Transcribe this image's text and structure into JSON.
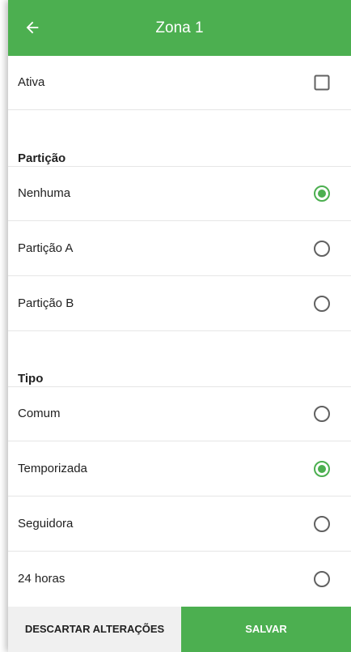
{
  "appbar": {
    "title": "Zona 1",
    "back_icon": "arrow-left-icon"
  },
  "colors": {
    "accent": "#4caf50",
    "control_unchecked": "#616161"
  },
  "ativa": {
    "label": "Ativa",
    "checked": false
  },
  "particao": {
    "header": "Partição",
    "options": [
      {
        "label": "Nenhuma",
        "selected": true
      },
      {
        "label": "Partição A",
        "selected": false
      },
      {
        "label": "Partição B",
        "selected": false
      }
    ]
  },
  "tipo": {
    "header": "Tipo",
    "options": [
      {
        "label": "Comum",
        "selected": false
      },
      {
        "label": "Temporizada",
        "selected": true
      },
      {
        "label": "Seguidora",
        "selected": false
      },
      {
        "label": "24 horas",
        "selected": false
      }
    ]
  },
  "actions": {
    "discard_label": "DESCARTAR ALTERAÇÕES",
    "save_label": "SALVAR"
  }
}
